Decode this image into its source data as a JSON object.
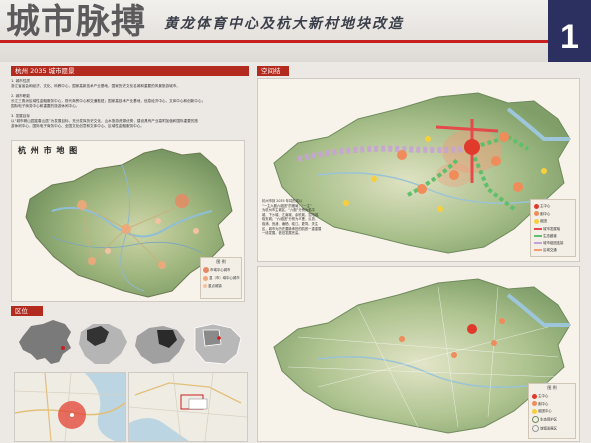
{
  "header": {
    "title": "城市脉搏",
    "subtitle": "黄龙体育中心及杭大新村地块改造",
    "page_number": "1"
  },
  "section_vision": {
    "title": "杭州 2035 城市愿景",
    "lines": [
      "1. 城市性质",
      "浙江省省会和经济、文化、科教中心，国家高新技术产业基地，国家历史文化名城和重要的风景旅游城市。",
      "2. 城市职能",
      "长江三角洲区域性金融服务中心，现代商贸中心和交通枢纽；国家高技术产业基地，信息经济中心，文体中心和创新中心；",
      "国际电子商务中心和重要的旅游休闲中心。",
      "3. 发展目标",
      "以“城市精山园富春山居”为发展目标，充分发挥历史文化，山水旅游资源优势，建设具有产业高附加值和国际重要的旅",
      "游休闲中心、国际电子商务中心、全国文化创意和文体中心、区域性金融服务中心。"
    ]
  },
  "map_hangzhou": {
    "title": "杭 州 市 地 图",
    "legend_title": "图    例",
    "legend_items": [
      "市域中心城市",
      "县（市）域中心城市",
      "重点城镇"
    ]
  },
  "section_location": {
    "title": "区位"
  },
  "section_structure": {
    "title": "空间结构",
    "description": [
      "杭州市到 2035 年将形成以",
      "“一主六副六组团”的格局，“一主”",
      "为杭州市主城区，“六副”分别为临平",
      "城、下沙城、江南城、余杭城、富阳城、",
      "临安城；“六组团”分别为义蓬、瓜沥、",
      "临浦、良渚、塘栖、临江。更简，关注",
      "区，城市为历史要脉承担的肌底一重重展",
      "一线发展，依旧发展完善。"
    ],
    "legend_items": [
      "主中心",
      "副中心",
      "组团",
      "城市发展轴",
      "生态廊道",
      "城市组团连接",
      "区域交通"
    ]
  },
  "map_bottom": {
    "legend_title": "图    例",
    "legend_items": [
      "主中心",
      "副中心",
      "组团中心",
      "生态保护区",
      "城镇发展区"
    ]
  }
}
